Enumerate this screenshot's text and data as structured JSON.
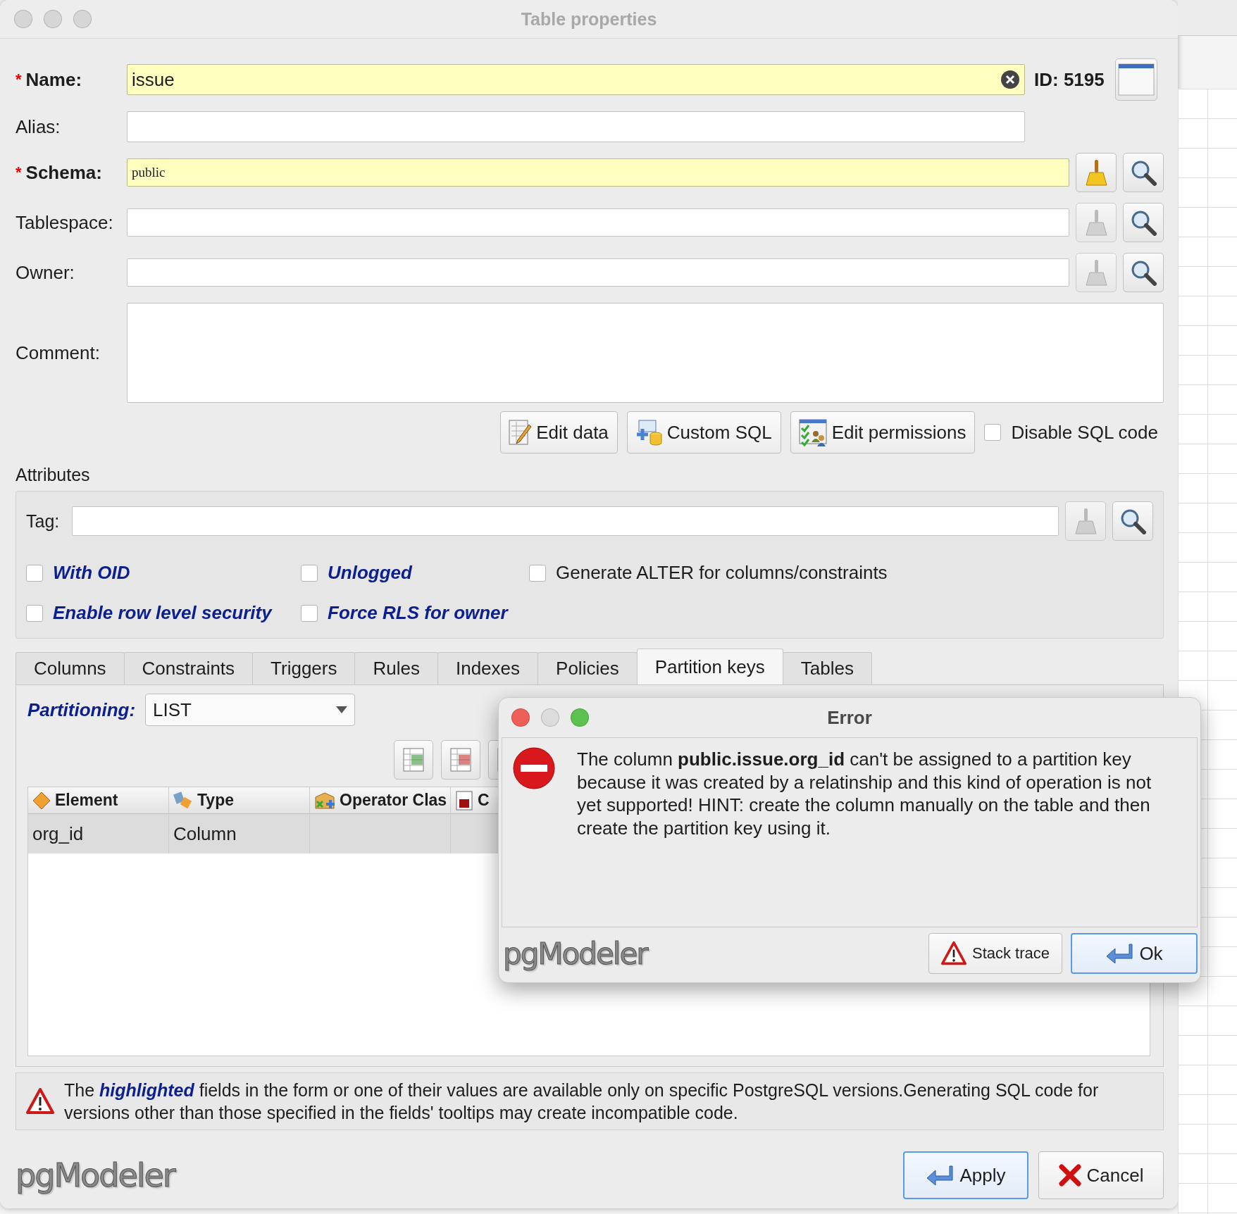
{
  "window": {
    "title": "Table properties"
  },
  "required_mark": "*",
  "fields": [
    {
      "kind": "name",
      "label": "Name:",
      "required": true,
      "value": "issue",
      "id_label": "ID: 5195"
    },
    {
      "kind": "text",
      "label": "Alias:",
      "required": false
    },
    {
      "kind": "picker",
      "label": "Schema:",
      "required": true,
      "value": "public",
      "clear_disabled": false
    },
    {
      "kind": "picker",
      "label": "Tablespace:",
      "required": false,
      "clear_disabled": true
    },
    {
      "kind": "picker",
      "label": "Owner:",
      "required": false,
      "clear_disabled": true
    },
    {
      "kind": "textarea",
      "label": "Comment:",
      "required": false
    }
  ],
  "actions": [
    {
      "label": "Edit data",
      "kind": "edit"
    },
    {
      "label": "Custom SQL",
      "kind": "sql"
    },
    {
      "label": "Edit permissions",
      "kind": "permissions"
    }
  ],
  "disable_sql": {
    "label": "Disable SQL code",
    "checked": false
  },
  "attributes": {
    "title": "Attributes",
    "tag": {
      "label": "Tag:",
      "clear_disabled": true
    },
    "options": [
      {
        "label": "With OID",
        "checked": false,
        "highlighted": true
      },
      {
        "label": "Unlogged",
        "checked": false,
        "highlighted": true
      },
      {
        "label": "Generate ALTER for columns/constraints",
        "checked": false,
        "highlighted": false
      },
      {
        "label": "Enable row level security",
        "checked": false,
        "highlighted": true
      },
      {
        "label": "Force RLS for owner",
        "checked": false,
        "highlighted": true
      }
    ]
  },
  "tabs": [
    {
      "label": "Columns",
      "selected": false
    },
    {
      "label": "Constraints",
      "selected": false
    },
    {
      "label": "Triggers",
      "selected": false
    },
    {
      "label": "Rules",
      "selected": false
    },
    {
      "label": "Indexes",
      "selected": false
    },
    {
      "label": "Policies",
      "selected": false
    },
    {
      "label": "Partition keys",
      "selected": true
    },
    {
      "label": "Tables",
      "selected": false
    }
  ],
  "partitioning": {
    "label": "Partitioning:",
    "value": "LIST"
  },
  "table": {
    "columns": [
      {
        "label": "Element",
        "kind": "element"
      },
      {
        "label": "Type",
        "kind": "type"
      },
      {
        "label": "Operator Clas",
        "kind": "opclass"
      },
      {
        "label": "C",
        "kind": "collation"
      }
    ],
    "rows": [
      {
        "cells": [
          "org_id",
          "Column"
        ],
        "selected": true
      }
    ]
  },
  "notice": "The **highlighted** fields in the form or one of their values are available only on specific PostgreSQL versions.Generating SQL code for versions other than those specified in the fields' tooltips may create incompatible code.",
  "footer": {
    "logo": "pgModeler",
    "buttons": [
      {
        "label": "Apply",
        "kind": "apply",
        "default": true
      },
      {
        "label": "Cancel",
        "kind": "cancel",
        "default": false
      }
    ]
  },
  "error_dialog": {
    "title": "Error",
    "message": "The column **public.issue.org_id** can't be assigned to a partition key because it was created by a relatinship and this kind of operation is not yet supported! HINT: create the column manually on the table and then create the partition key using it.",
    "logo": "pgModeler",
    "buttons": [
      {
        "label": "Stack trace",
        "kind": "trace",
        "default": false
      },
      {
        "label": "Ok",
        "kind": "ok",
        "default": true
      }
    ]
  }
}
